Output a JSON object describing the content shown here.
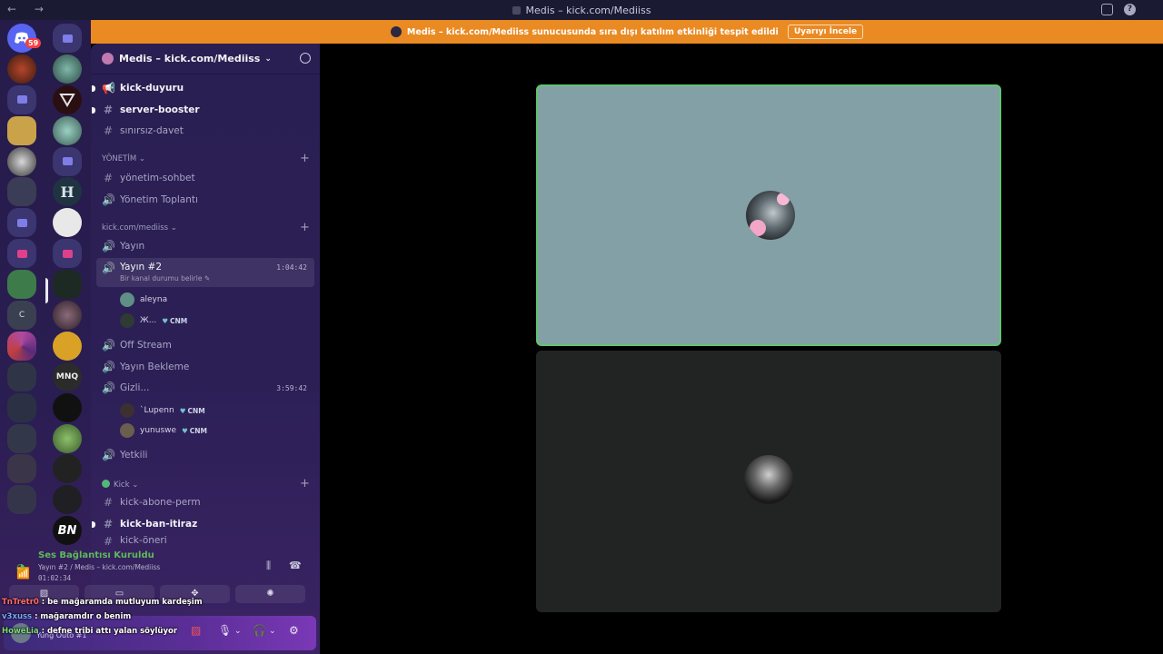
{
  "window": {
    "title": "Medis – kick.com/Mediiss",
    "nav_arrows": "← →"
  },
  "banner": {
    "text": "Medis – kick.com/Mediiss sunucusunda sıra dışı katılım etkinliği tespit edildi",
    "button": "Uyarıyı İncele"
  },
  "rail": {
    "badge": "59"
  },
  "server": {
    "name": "Medis – kick.com/Mediiss"
  },
  "channels": {
    "top": [
      {
        "name": "kick-duyuru",
        "icon": "megaphone-icon"
      },
      {
        "name": "server-booster",
        "icon": "hash-icon"
      },
      {
        "name": "sınırsız-davet",
        "icon": "hash-icon"
      }
    ],
    "cat_yonetim": "YÖNETİM",
    "yonetim": [
      {
        "name": "yönetim-sohbet",
        "icon": "hash-icon"
      },
      {
        "name": "Yönetim Toplantı",
        "icon": "speaker-icon"
      }
    ],
    "cat_kick": "kick.com/mediiss",
    "yayin": "Yayın",
    "yayin2": {
      "name": "Yayın #2",
      "timer": "1:04:42",
      "status": "Bir kanal durumu belirle"
    },
    "yayin2_members": [
      {
        "name": "aleyna",
        "tag": ""
      },
      {
        "name": "Ж...",
        "tag": "CNM"
      }
    ],
    "off_stream": "Off Stream",
    "yayin_bekleme": "Yayın Bekleme",
    "gizli": {
      "name": "Gizli...",
      "timer": "3:59:42"
    },
    "gizli_members": [
      {
        "name": "`Lupenn",
        "tag": "CNM"
      },
      {
        "name": "yunuswe",
        "tag": "CNM"
      }
    ],
    "yetkili": "Yetkili",
    "cat_kick2": "Kick",
    "kick_channels": [
      {
        "name": "kick-abone-perm"
      },
      {
        "name": "kick-ban-itiraz"
      },
      {
        "name": "kick-öneri"
      }
    ]
  },
  "voice": {
    "status": "Ses Bağlantısı Kuruldu",
    "channel": "Yayın #2 / Medis – kick.com/Mediiss",
    "time": "01:02:34"
  },
  "user": {
    "name": "Yung Outo #1"
  },
  "chat_overlay": [
    {
      "user": "TnTretr0",
      "text": " : be mağaramda mutluyum kardeşim"
    },
    {
      "user": "v3xuss",
      "text": " : mağaramdır o benim"
    },
    {
      "user": "HoweLia",
      "text": " : defne tribi attı yalan söylüyor"
    }
  ],
  "colors": {
    "banner": "#ea8a22",
    "speaking_border": "#62c46f",
    "voice_ok": "#5fb85c",
    "mention": "#f23f43"
  }
}
